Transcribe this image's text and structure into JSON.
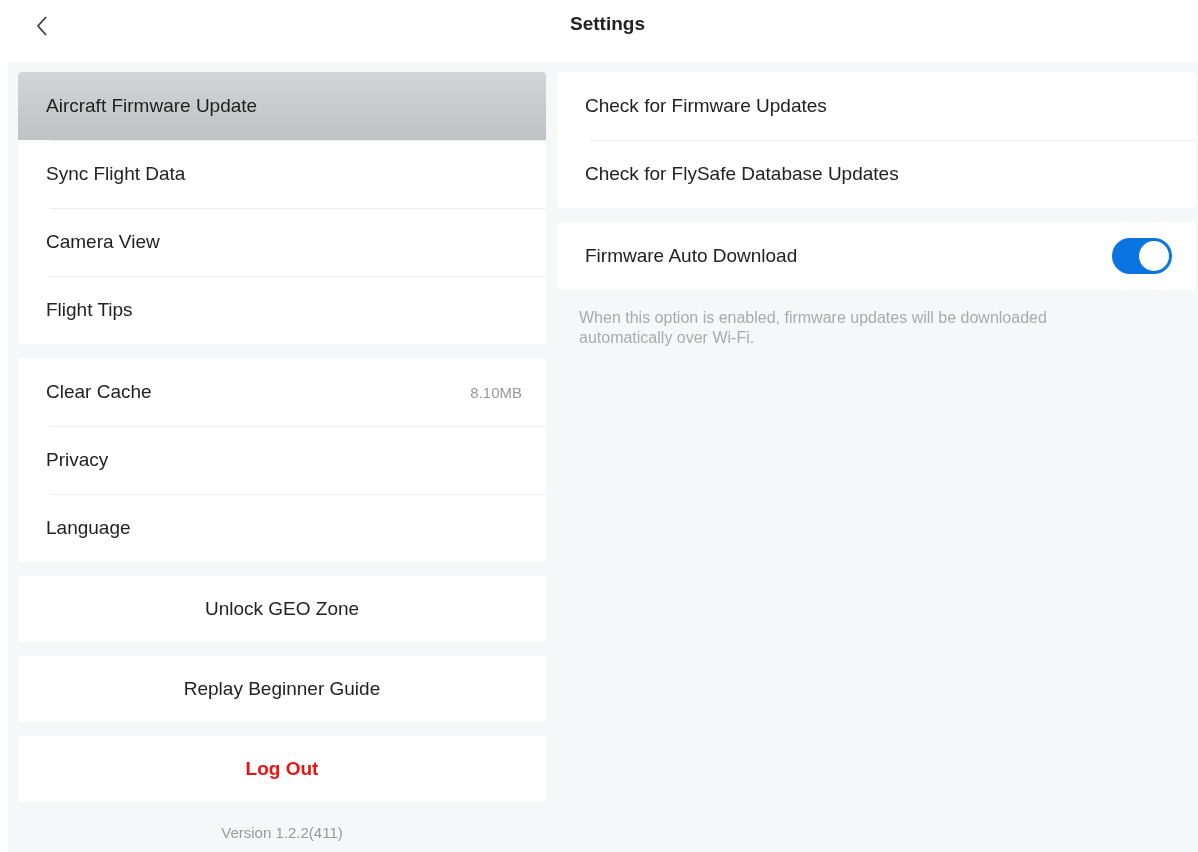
{
  "header": {
    "title": "Settings"
  },
  "menu_groups": [
    {
      "items": [
        {
          "label": "Aircraft Firmware Update",
          "selected": true
        },
        {
          "label": "Sync Flight Data",
          "selected": false
        },
        {
          "label": "Camera View",
          "selected": false
        },
        {
          "label": "Flight Tips",
          "selected": false
        }
      ]
    },
    {
      "items": [
        {
          "label": "Clear Cache",
          "value": "8.10MB",
          "selected": false
        },
        {
          "label": "Privacy",
          "selected": false
        },
        {
          "label": "Language",
          "selected": false
        }
      ]
    }
  ],
  "actions": [
    {
      "label": "Unlock GEO Zone",
      "kind": "normal"
    },
    {
      "label": "Replay Beginner Guide",
      "kind": "normal"
    },
    {
      "label": "Log Out",
      "kind": "danger"
    }
  ],
  "version": "Version 1.2.2(411)",
  "detail": {
    "items": [
      "Check for Firmware Updates",
      "Check for FlySafe Database Updates"
    ],
    "toggle": {
      "label": "Firmware Auto Download",
      "on": true
    },
    "description": "When this option is enabled, firmware updates will be downloaded automatically over Wi-Fi."
  }
}
